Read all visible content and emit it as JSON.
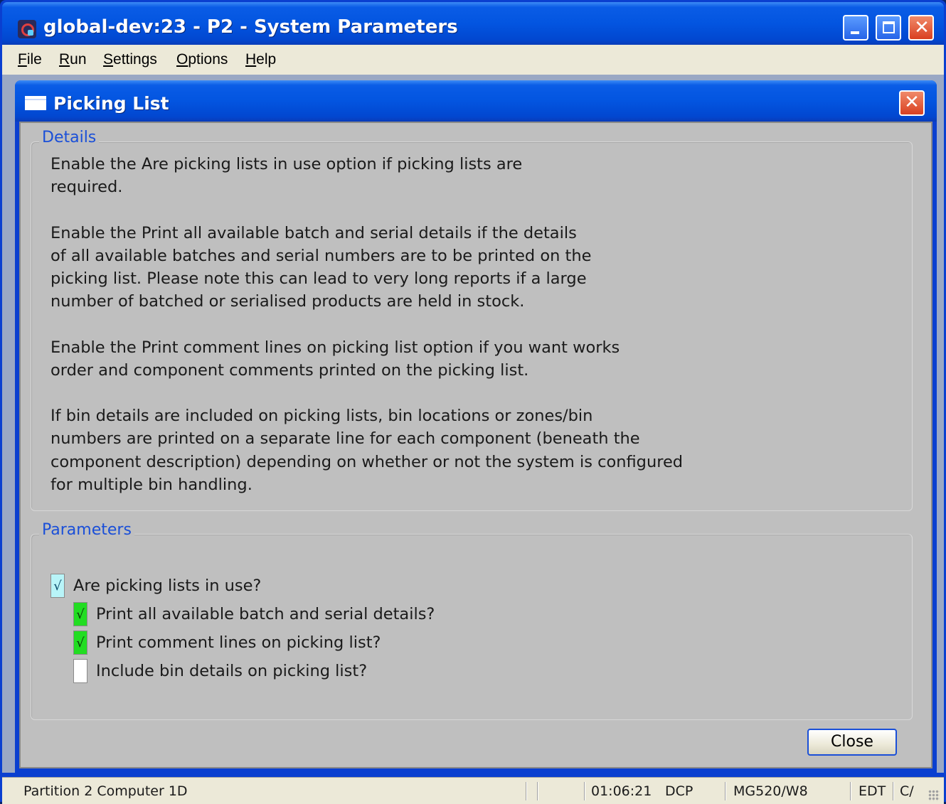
{
  "window": {
    "title": "global-dev:23 - P2 - System Parameters"
  },
  "menu": {
    "items": [
      {
        "first": "F",
        "rest": "ile"
      },
      {
        "first": "R",
        "rest": "un"
      },
      {
        "first": "S",
        "rest": "ettings"
      },
      {
        "first": "O",
        "rest": "ptions"
      },
      {
        "first": "H",
        "rest": "elp"
      }
    ]
  },
  "dialog": {
    "title": "Picking List",
    "details": {
      "label": "Details",
      "paragraphs": [
        "Enable the Are picking lists in use option if picking lists are\nrequired.",
        "Enable the Print all available batch and serial details if the details\nof all available batches and serial numbers are to be printed on the\npicking list. Please note this can lead to very long reports if a large\nnumber of batched or serialised products are held in stock.",
        "Enable the Print comment lines on picking list option if you want works\norder and component comments printed on the picking list.",
        "If bin details are included on picking lists, bin locations or zones/bin\nnumbers are printed on a separate line for each component (beneath the\ncomponent description) depending on whether or not the system is configured\nfor multiple bin handling."
      ]
    },
    "parameters": {
      "label": "Parameters",
      "options": [
        {
          "label": "Are picking lists in use?",
          "checked": true,
          "mark": "√",
          "color": "#b8f4f8"
        },
        {
          "label": "Print all available batch and serial details?",
          "checked": true,
          "mark": "√",
          "color": "#22dd22"
        },
        {
          "label": "Print comment lines on picking list?",
          "checked": true,
          "mark": "√",
          "color": "#22dd22"
        },
        {
          "label": "Include bin details on picking list?",
          "checked": false,
          "mark": "",
          "color": "#ffffff"
        }
      ]
    },
    "close_label": "Close"
  },
  "status": {
    "partition": "Partition 2 Computer 1D",
    "time": "01:06:21",
    "mode": "DCP",
    "program": "MG520/W8",
    "edit": "EDT",
    "caps": "C/"
  }
}
